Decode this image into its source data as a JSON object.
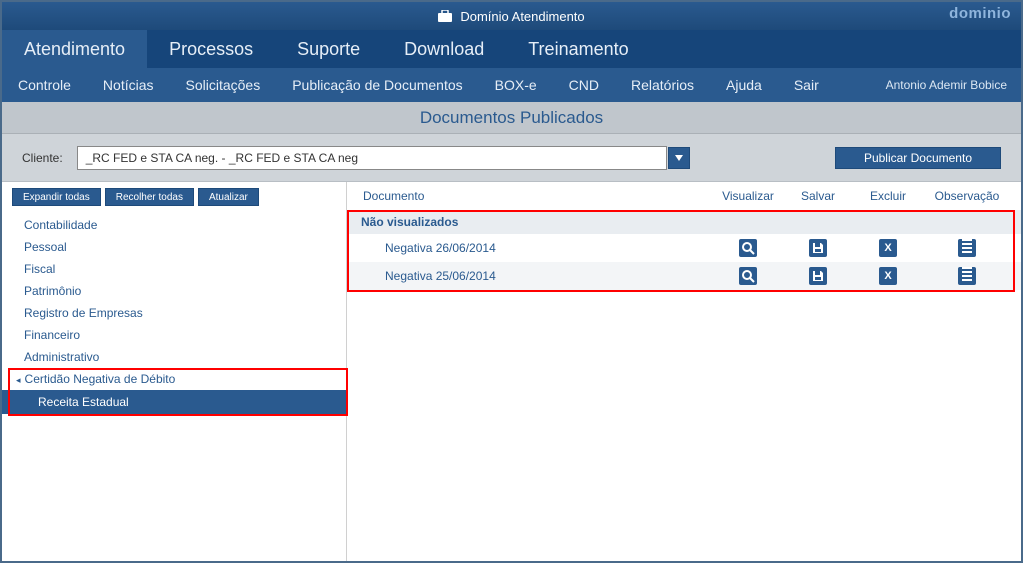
{
  "titlebar": {
    "title": "Domínio Atendimento",
    "brand": "dominio"
  },
  "main_tabs": [
    "Atendimento",
    "Processos",
    "Suporte",
    "Download",
    "Treinamento"
  ],
  "main_tab_active": 0,
  "sub_tabs": [
    "Controle",
    "Notícias",
    "Solicitações",
    "Publicação de Documentos",
    "BOX-e",
    "CND",
    "Relatórios",
    "Ajuda",
    "Sair"
  ],
  "user_name": "Antonio Ademir Bobice",
  "page_title": "Documentos Publicados",
  "client": {
    "label": "Cliente:",
    "value": "_RC FED e STA CA neg. - _RC FED e STA CA neg"
  },
  "publish_btn": "Publicar Documento",
  "mini_buttons": [
    "Expandir todas",
    "Recolher todas",
    "Atualizar"
  ],
  "tree": {
    "items": [
      {
        "label": "Contabilidade"
      },
      {
        "label": "Pessoal"
      },
      {
        "label": "Fiscal"
      },
      {
        "label": "Patrimônio"
      },
      {
        "label": "Registro de Empresas"
      },
      {
        "label": "Financeiro"
      },
      {
        "label": "Administrativo"
      }
    ],
    "expanded": {
      "label": "Certidão Negativa de Débito",
      "child": "Receita Estadual"
    }
  },
  "table": {
    "headers": {
      "doc": "Documento",
      "view": "Visualizar",
      "save": "Salvar",
      "del": "Excluir",
      "obs": "Observação"
    },
    "section": "Não visualizados",
    "rows": [
      {
        "name": "Negativa 26/06/2014"
      },
      {
        "name": "Negativa 25/06/2014"
      }
    ]
  }
}
